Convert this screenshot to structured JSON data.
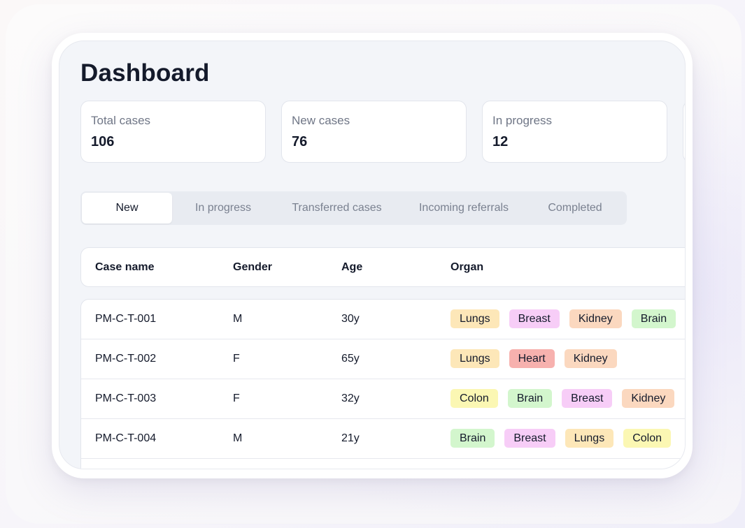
{
  "title": "Dashboard",
  "stats": [
    {
      "label": "Total cases",
      "value": "106"
    },
    {
      "label": "New cases",
      "value": "76"
    },
    {
      "label": "In progress",
      "value": "12"
    }
  ],
  "tabs": [
    "New",
    "In progress",
    "Transferred cases",
    "Incoming referrals",
    "Completed"
  ],
  "active_tab": "New",
  "table": {
    "headers": [
      "Case name",
      "Gender",
      "Age",
      "Organ"
    ],
    "rows": [
      {
        "case": "PM-C-T-001",
        "gender": "M",
        "age": "30y",
        "organs": [
          "Lungs",
          "Breast",
          "Kidney",
          "Brain"
        ]
      },
      {
        "case": "PM-C-T-002",
        "gender": "F",
        "age": "65y",
        "organs": [
          "Lungs",
          "Heart",
          "Kidney"
        ]
      },
      {
        "case": "PM-C-T-003",
        "gender": "F",
        "age": "32y",
        "organs": [
          "Colon",
          "Brain",
          "Breast",
          "Kidney"
        ]
      },
      {
        "case": "PM-C-T-004",
        "gender": "M",
        "age": "21y",
        "organs": [
          "Brain",
          "Breast",
          "Lungs",
          "Colon"
        ]
      }
    ]
  },
  "organ_colors": {
    "Lungs": "#fde7b8",
    "Breast": "#f7cdf7",
    "Kidney": "#fbd8bf",
    "Brain": "#d3f6cd",
    "Heart": "#f7b1ae",
    "Colon": "#fbf7b3"
  }
}
